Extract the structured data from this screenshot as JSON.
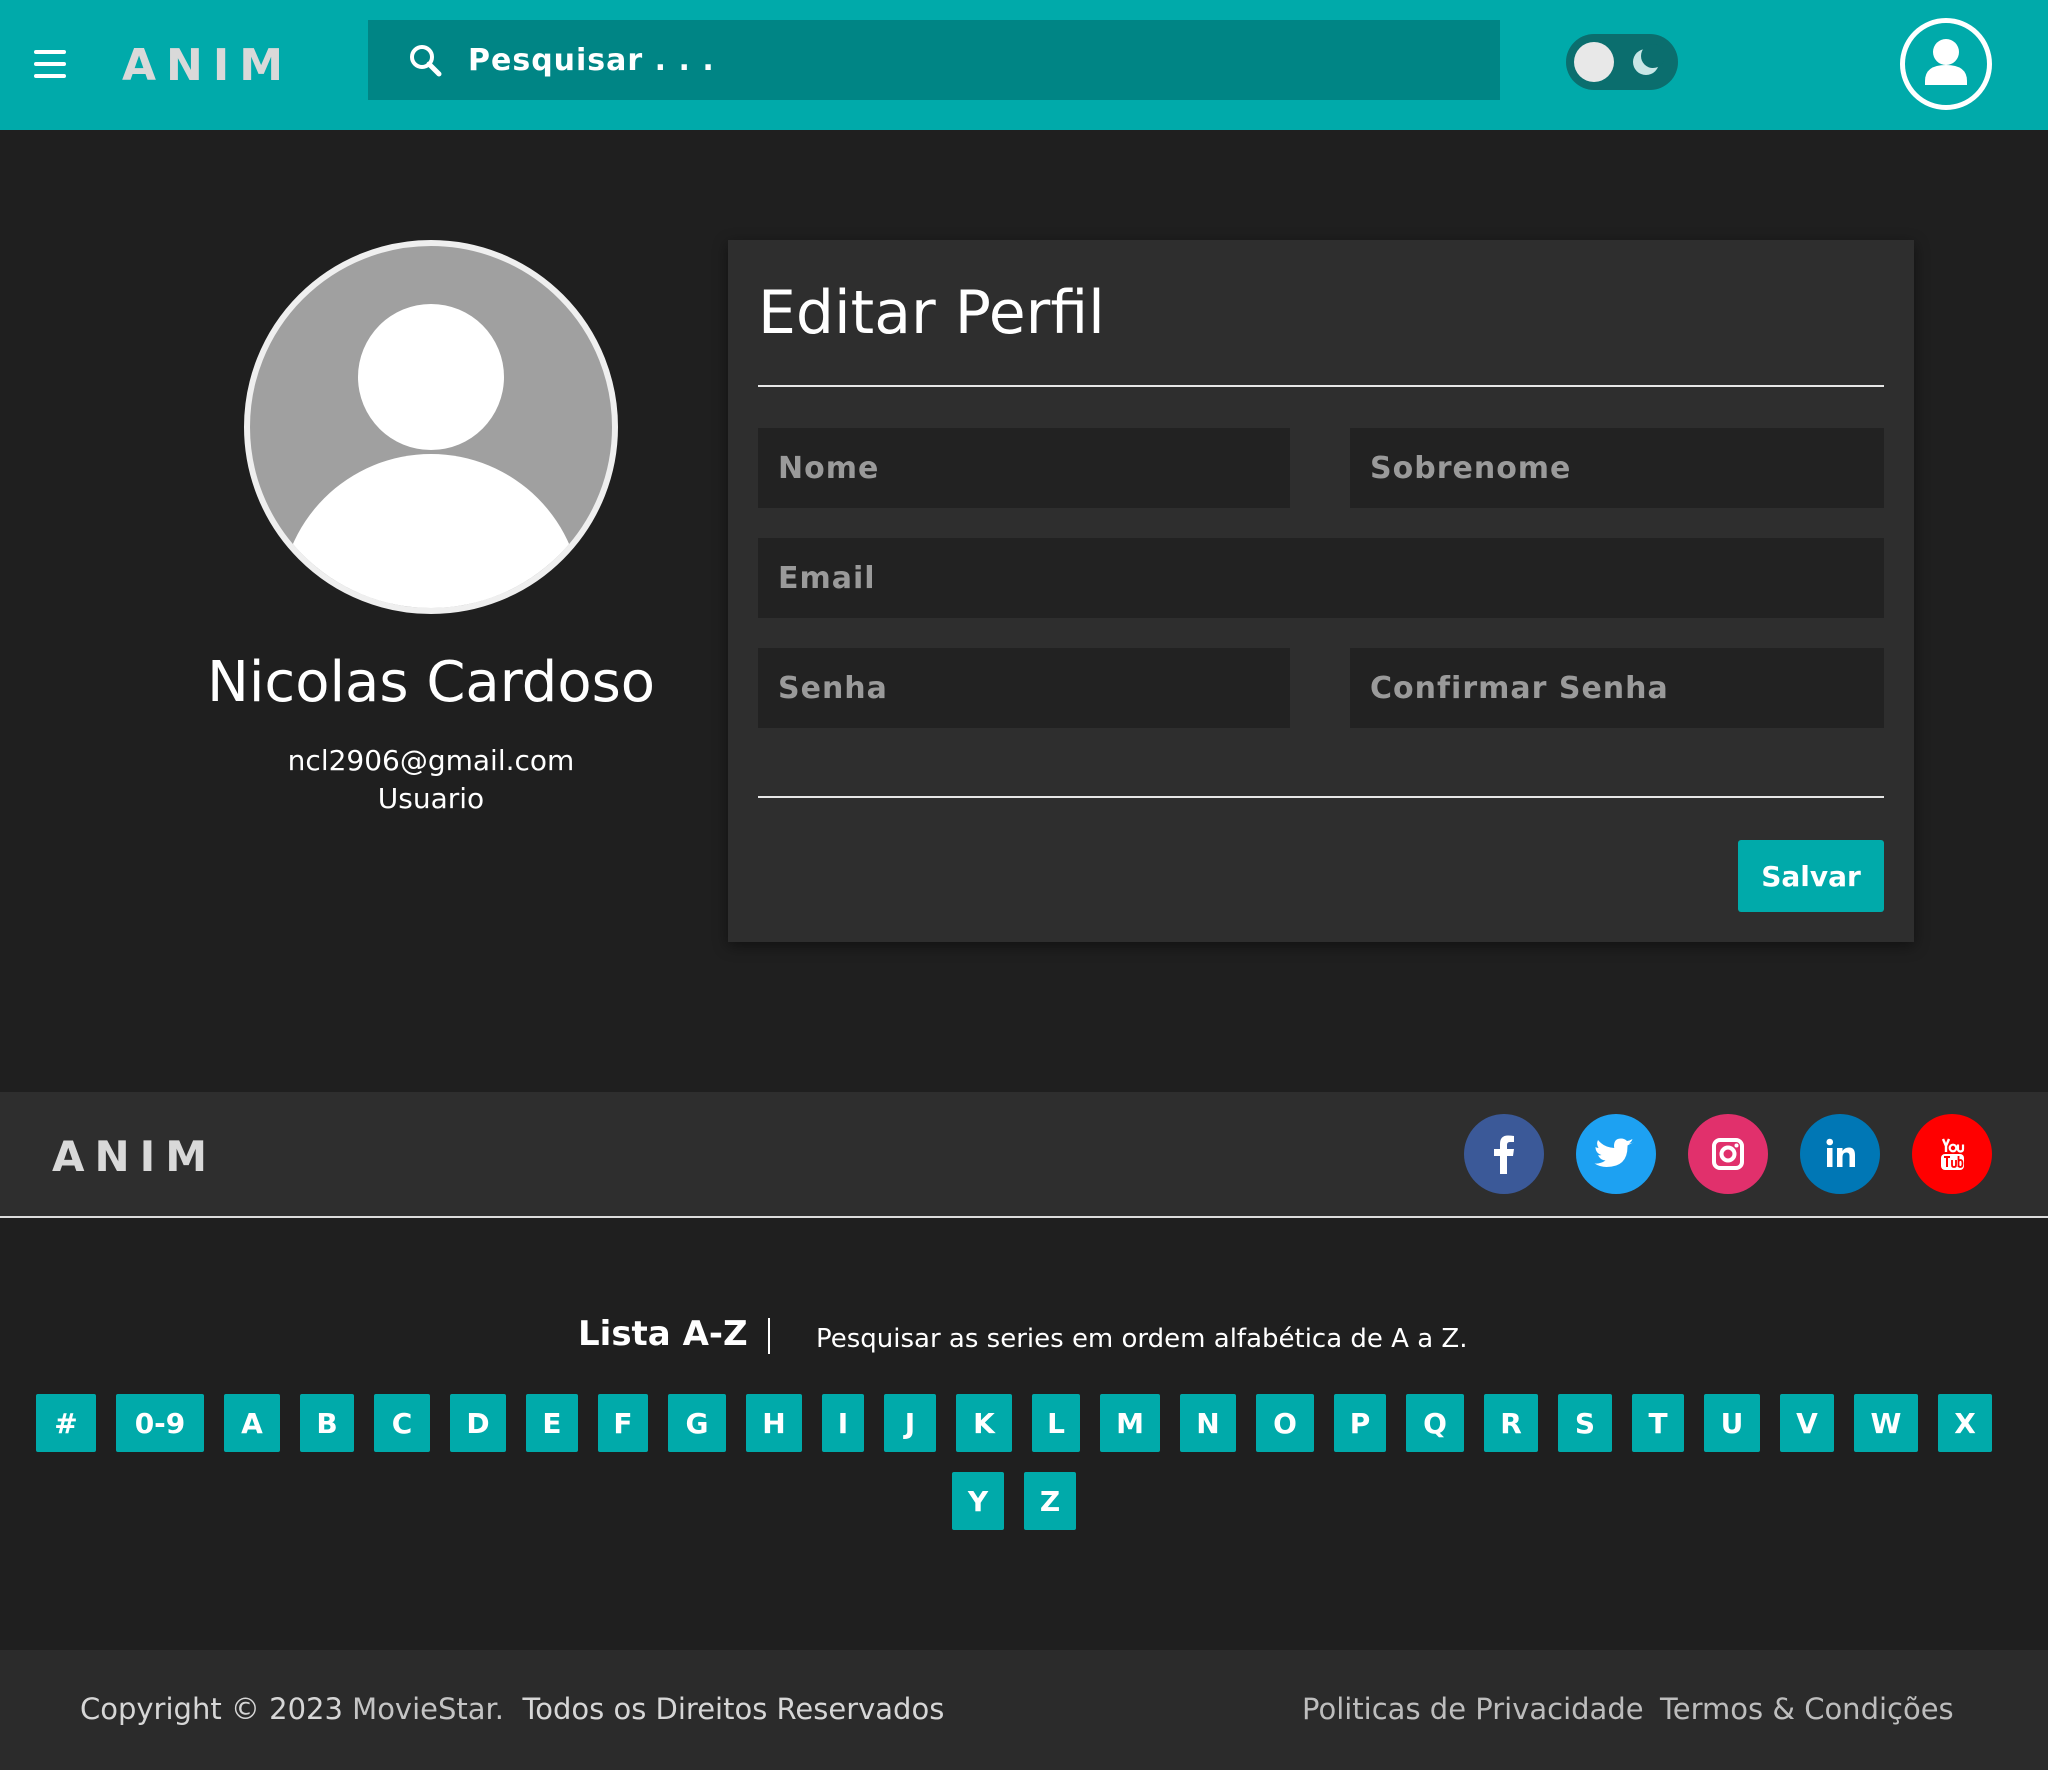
{
  "header": {
    "logo": "ANIM",
    "search_placeholder": "Pesquisar . . ."
  },
  "profile": {
    "name": "Nicolas Cardoso",
    "email": "ncl2906@gmail.com",
    "role": "Usuario"
  },
  "edit_profile": {
    "title": "Editar Perfil",
    "fields": {
      "first_name": "Nome",
      "last_name": "Sobrenome",
      "email": "Email",
      "password": "Senha",
      "confirm_password": "Confirmar Senha"
    },
    "save_label": "Salvar"
  },
  "footer": {
    "logo": "ANIM",
    "social": [
      {
        "name": "facebook",
        "color": "#3b5998"
      },
      {
        "name": "twitter",
        "color": "#1da1f2"
      },
      {
        "name": "instagram",
        "color": "#e1306c"
      },
      {
        "name": "linkedin",
        "color": "#0077b5"
      },
      {
        "name": "youtube",
        "color": "#ff0000"
      }
    ],
    "az": {
      "title": "Lista A-Z",
      "description": "Pesquisar as series em ordem alfabética de A a Z.",
      "letters": [
        "#",
        "0-9",
        "A",
        "B",
        "C",
        "D",
        "E",
        "F",
        "G",
        "H",
        "I",
        "J",
        "K",
        "L",
        "M",
        "N",
        "O",
        "P",
        "Q",
        "R",
        "S",
        "T",
        "U",
        "V",
        "W",
        "X",
        "Y",
        "Z"
      ]
    },
    "copyright_prefix": "Copyright © 2023",
    "copyright_brand": "MovieStar.",
    "copyright_suffix": "Todos os Direitos Reservados",
    "links": {
      "privacy": "Politicas de Privacidade",
      "terms": "Termos & Condições"
    }
  },
  "colors": {
    "accent": "#00aaaa",
    "background": "#1f1f1f",
    "panel": "#2e2e2e"
  }
}
